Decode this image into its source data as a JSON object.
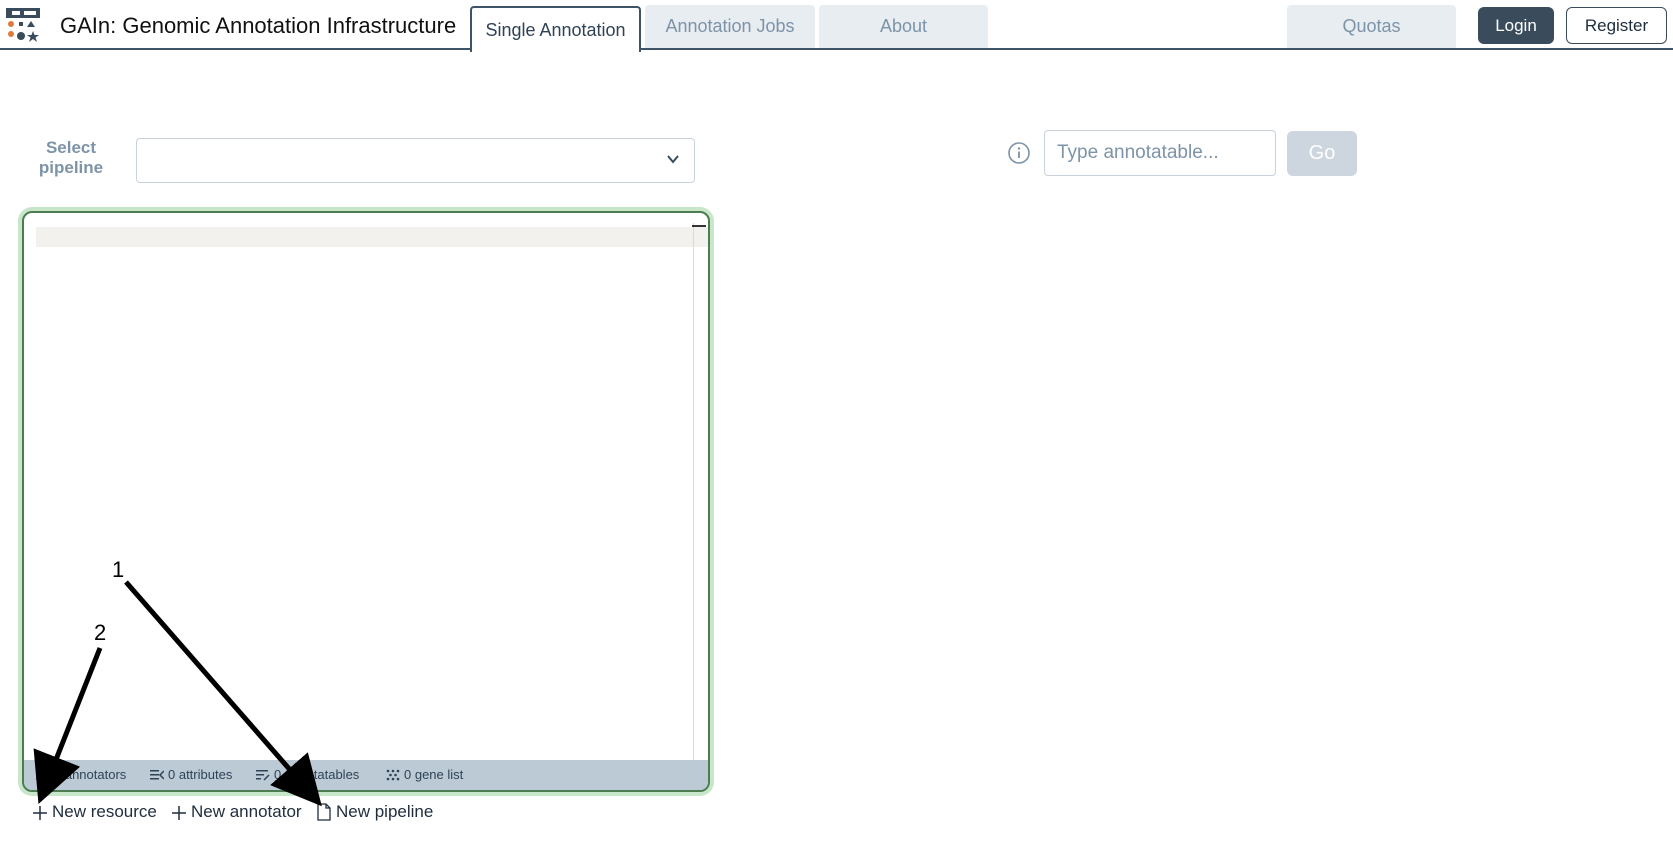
{
  "header": {
    "app_title": "GAIn: Genomic Annotation Infrastructure",
    "tabs": [
      {
        "label": "Single Annotation",
        "active": true
      },
      {
        "label": "Annotation Jobs",
        "active": false
      },
      {
        "label": "About",
        "active": false
      }
    ],
    "quotas_label": "Quotas",
    "login_label": "Login",
    "register_label": "Register"
  },
  "pipeline": {
    "select_label": "Select pipeline",
    "selected_value": ""
  },
  "editor": {
    "status": {
      "annotators": "0 annotators",
      "attributes": "0 attributes",
      "annotatables": "0 annotatables",
      "gene_list": "0 gene list"
    }
  },
  "actions": {
    "new_resource": "New resource",
    "new_annotator": "New annotator",
    "new_pipeline": "New pipeline"
  },
  "annotatable": {
    "placeholder": "Type annotatable...",
    "go_label": "Go"
  },
  "callouts": {
    "one": "1",
    "two": "2"
  },
  "colors": {
    "primary_dark": "#3a4b5c",
    "tab_inactive_bg": "#e8edf2",
    "tab_inactive_text": "#7d93a8",
    "editor_border": "#4d7c50",
    "statusbar_bg": "#bccad6",
    "go_disabled_bg": "#cdd6de"
  }
}
